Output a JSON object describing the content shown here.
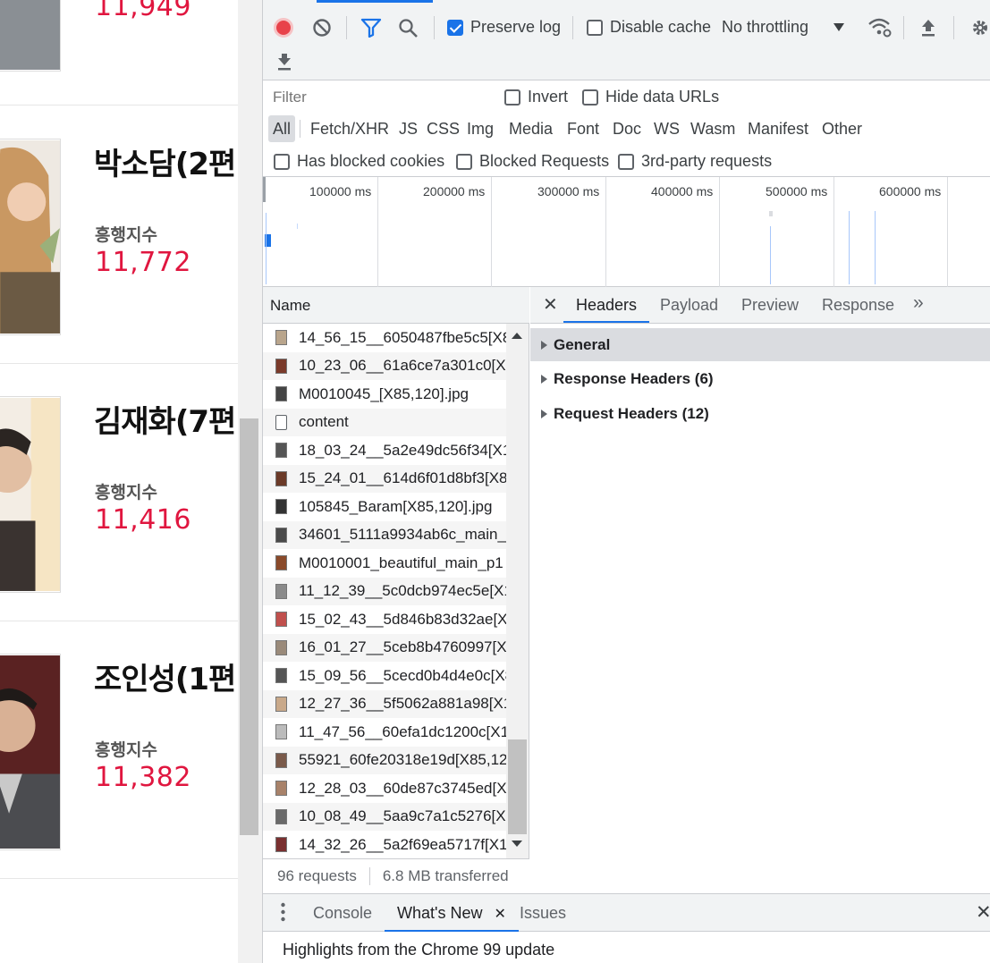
{
  "page": {
    "index_label": "흥행지수",
    "cards": [
      {
        "name": "",
        "value": "11,949"
      },
      {
        "name": "박소담(2편",
        "value": "11,772"
      },
      {
        "name": "김재화(7편",
        "value": "11,416"
      },
      {
        "name": "조인성(1편",
        "value": "11,382"
      }
    ]
  },
  "devtools": {
    "toolbar": {
      "preserve_log": "Preserve log",
      "disable_cache": "Disable cache",
      "throttling": "No throttling"
    },
    "filter": {
      "placeholder": "Filter",
      "invert": "Invert",
      "hide_data_urls": "Hide data URLs",
      "types": [
        "All",
        "Fetch/XHR",
        "JS",
        "CSS",
        "Img",
        "Media",
        "Font",
        "Doc",
        "WS",
        "Wasm",
        "Manifest",
        "Other"
      ],
      "has_blocked_cookies": "Has blocked cookies",
      "blocked_requests": "Blocked Requests",
      "third_party": "3rd-party requests"
    },
    "overview": {
      "ticks": [
        "100000 ms",
        "200000 ms",
        "300000 ms",
        "400000 ms",
        "500000 ms",
        "600000 ms"
      ]
    },
    "network": {
      "name_header": "Name",
      "requests": [
        "14_56_15__6050487fbe5c5[X8",
        "10_23_06__61a6ce7a301c0[X8",
        "M0010045_[X85,120].jpg",
        "content",
        "18_03_24__5a2e49dc56f34[X1",
        "15_24_01__614d6f01d8bf3[X8",
        "105845_Baram[X85,120].jpg",
        "34601_5111a9934ab6c_main_",
        "M0010001_beautiful_main_p1",
        "11_12_39__5c0dcb974ec5e[X1",
        "15_02_43__5d846b83d32ae[X",
        "16_01_27__5ceb8b4760997[X.",
        "15_09_56__5cecd0b4d4e0c[X8",
        "12_27_36__5f5062a881a98[X1",
        "11_47_56__60efa1dc1200c[X1",
        "55921_60fe20318e19d[X85,12",
        "12_28_03__60de87c3745ed[X.",
        "10_08_49__5aa9c7a1c5276[X8",
        "14_32_26__5a2f69ea5717f[X1."
      ],
      "summary_requests": "96 requests",
      "summary_transferred": "6.8 MB transferred"
    },
    "details": {
      "tabs": [
        "Headers",
        "Payload",
        "Preview",
        "Response"
      ],
      "sections": [
        "General",
        "Response Headers (6)",
        "Request Headers (12)"
      ]
    },
    "drawer": {
      "tabs": [
        "Console",
        "What's New",
        "Issues"
      ],
      "content": "Highlights from the Chrome 99 update"
    }
  }
}
